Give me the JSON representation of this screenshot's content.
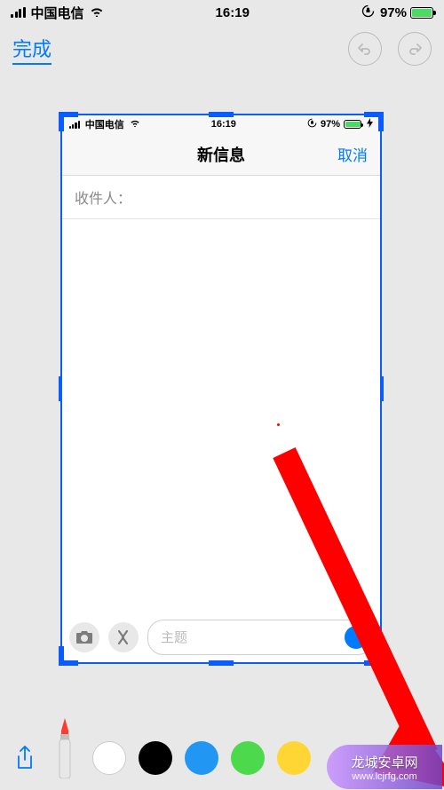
{
  "outer_status": {
    "carrier": "中国电信",
    "time": "16:19",
    "battery_pct": "97%"
  },
  "outer_toolbar": {
    "done_label": "完成"
  },
  "inner_status": {
    "carrier": "中国电信",
    "time": "16:19",
    "battery_pct": "97%"
  },
  "inner_nav": {
    "title": "新信息",
    "cancel_label": "取消"
  },
  "recipient": {
    "label": "收件人："
  },
  "compose": {
    "subject_placeholder": "主题"
  },
  "colors": {
    "items": [
      "white",
      "black",
      "blue",
      "green",
      "yellow"
    ]
  },
  "watermark": {
    "line1": "龙城安卓网",
    "line2": "www.lcjrfg.com"
  }
}
